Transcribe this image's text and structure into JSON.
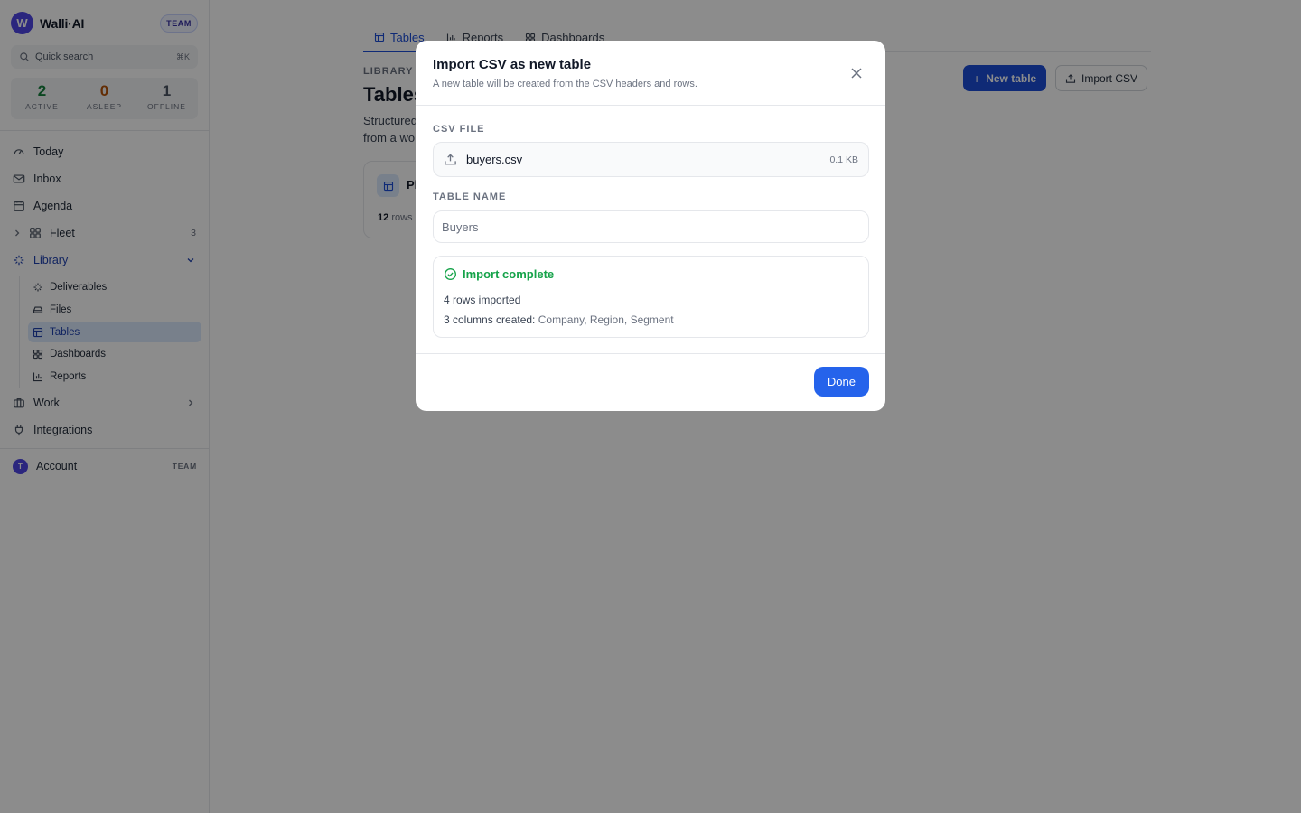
{
  "app": {
    "name": "Walli·AI",
    "logo_letter": "W",
    "plan_badge": "TEAM"
  },
  "search": {
    "label": "Quick search",
    "shortcut": "⌘K"
  },
  "status": {
    "active": {
      "count": "2",
      "label": "ACTIVE",
      "color": "#15803d"
    },
    "asleep": {
      "count": "0",
      "label": "ASLEEP",
      "color": "#b45309"
    },
    "offline": {
      "count": "1",
      "label": "OFFLINE",
      "color": "#4b5563"
    }
  },
  "nav": {
    "today": "Today",
    "inbox": "Inbox",
    "agenda": "Agenda",
    "fleet": {
      "label": "Fleet",
      "count": "3"
    },
    "library": "Library",
    "library_items": {
      "deliverables": "Deliverables",
      "files": "Files",
      "tables": "Tables",
      "dashboards": "Dashboards",
      "reports": "Reports"
    },
    "work": "Work",
    "integrations": "Integrations"
  },
  "account": {
    "avatar": "T",
    "name": "Account",
    "badge": "TEAM"
  },
  "main": {
    "tabs": {
      "tables": "Tables",
      "reports": "Reports",
      "dashboards": "Dashboards"
    },
    "eyebrow": "LIBRARY",
    "title": "Tables",
    "description_line1": "Structured",
    "description_line2": "from a wo",
    "new_table": "New table",
    "import_csv": "Import CSV",
    "card": {
      "name": "Pi",
      "rows_count": "12",
      "rows_label": "rows"
    }
  },
  "modal": {
    "title": "Import CSV as new table",
    "subtitle": "A new table will be created from the CSV headers and rows.",
    "file_label": "CSV FILE",
    "file_name": "buyers.csv",
    "file_size": "0.1 KB",
    "name_label": "TABLE NAME",
    "name_value": "Buyers",
    "result_title": "Import complete",
    "rows_imported": "4 rows imported",
    "columns_prefix": "3 columns created:",
    "columns_list": "Company, Region, Segment",
    "done_label": "Done"
  },
  "colors": {
    "accent": "#1d4ed8",
    "success": "#16a34a",
    "brand": "#4f46e5"
  }
}
